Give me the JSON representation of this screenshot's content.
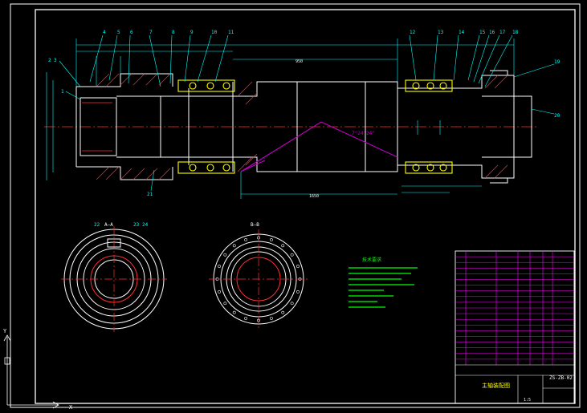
{
  "drawing": {
    "colors": {
      "background": "#000000",
      "frame": "#ffffff",
      "outline": "#ffffff",
      "dimension": "#00ffff",
      "centerline": "#ff3030",
      "hatch": "#ff3030",
      "bearing": "#ffff00",
      "taper": "#c000c0",
      "notes": "#00ff00",
      "table": "#ff00ff",
      "balloon": "#00ffff"
    },
    "part_numbers_top": [
      "4",
      "5",
      "6",
      "7",
      "8",
      "9",
      "10",
      "11",
      "12",
      "13",
      "14",
      "15",
      "16",
      "17",
      "18"
    ],
    "part_numbers_left": [
      "2",
      "3",
      "1"
    ],
    "part_numbers_right": [
      "19",
      "20"
    ],
    "part_numbers_bottom": [
      "21"
    ],
    "section_labels": [
      "A—A",
      "B—B"
    ],
    "section_a_numbers": [
      "22",
      "23",
      "24"
    ],
    "taper_angle": "7°24'24\"",
    "dim_overall": "950",
    "dim_bottom": "1650",
    "notes_title": "技术要求",
    "title_block": {
      "drawing_title": "主轴装配图",
      "drawing_code": "ZS-ZB-02",
      "scale": "1:5"
    }
  }
}
